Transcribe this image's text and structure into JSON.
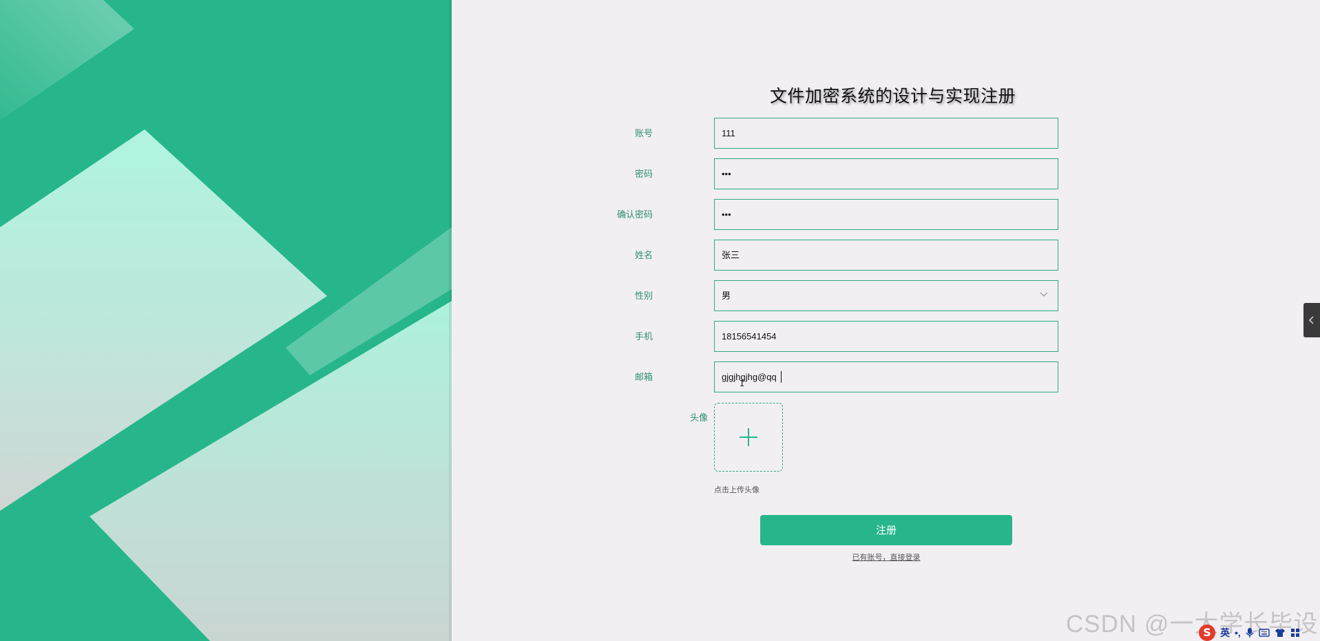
{
  "form": {
    "title": "文件加密系统的设计与实现注册",
    "fields": [
      {
        "label": "账号",
        "value": "111",
        "type": "text"
      },
      {
        "label": "密码",
        "value": "•••",
        "type": "password"
      },
      {
        "label": "确认密码",
        "value": "•••",
        "type": "password"
      },
      {
        "label": "姓名",
        "value": "张三",
        "type": "text"
      },
      {
        "label": "性别",
        "value": "男",
        "type": "select"
      },
      {
        "label": "手机",
        "value": "18156541454",
        "type": "text"
      },
      {
        "label": "邮箱",
        "value": "gjgjhgjhg@qq",
        "type": "text"
      }
    ],
    "avatar": {
      "label": "头像",
      "hint": "点击上传头像",
      "icon": "plus-icon"
    },
    "submit_label": "注册",
    "login_link": "已有账号，直接登录"
  },
  "watermark": "CSDN @一大学长毕设",
  "ime": {
    "mode_label": "英",
    "punct_label": "•,"
  },
  "colors": {
    "accent": "#27b68b",
    "label": "#2f8f72",
    "background": "#f1eff2"
  }
}
